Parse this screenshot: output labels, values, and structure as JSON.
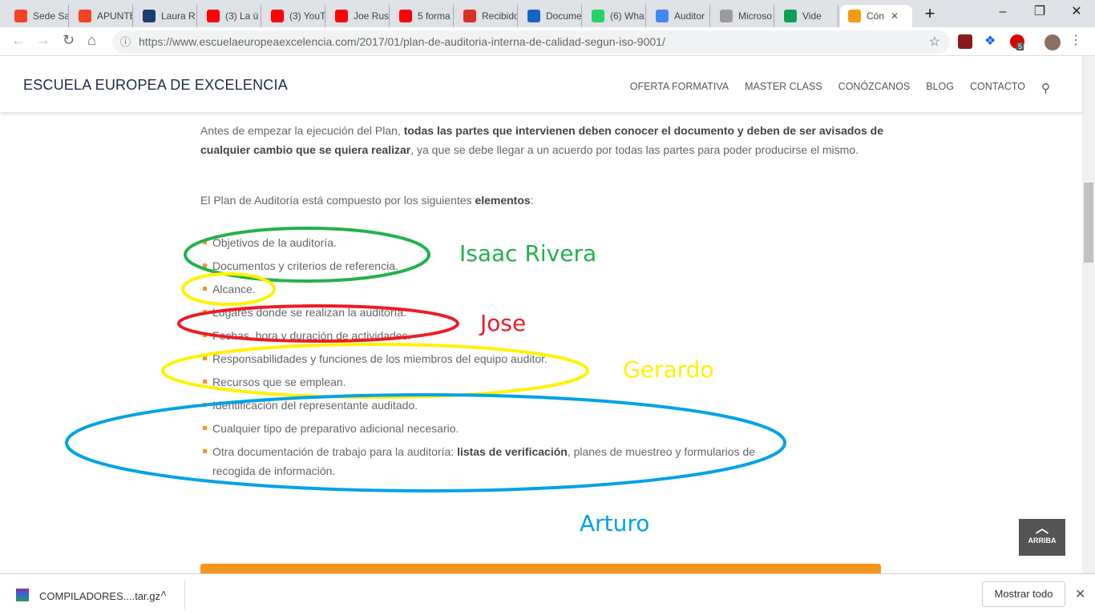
{
  "browser": {
    "tabs": [
      {
        "label": "Sede Sa",
        "icon": "joomla-icon",
        "color": "#f44321"
      },
      {
        "label": "APUNTE",
        "icon": "joomla-icon",
        "color": "#f44321"
      },
      {
        "label": "Laura R",
        "icon": "linkedin-learning-icon",
        "color": "#1b3c6e"
      },
      {
        "label": "(3) La ú",
        "icon": "youtube-icon",
        "color": "#ff0000"
      },
      {
        "label": "(3) YouT",
        "icon": "youtube-icon",
        "color": "#ff0000"
      },
      {
        "label": "Joe Rus",
        "icon": "youtube-icon",
        "color": "#ff0000"
      },
      {
        "label": "5 forma",
        "icon": "youtube-icon",
        "color": "#ff0000"
      },
      {
        "label": "Recibido",
        "icon": "gmail-icon",
        "color": "#d93025"
      },
      {
        "label": "Docume",
        "icon": "td-icon",
        "color": "#1565c0"
      },
      {
        "label": "(6) Wha",
        "icon": "whatsapp-icon",
        "color": "#25d366"
      },
      {
        "label": "Auditor",
        "icon": "google-docs-icon",
        "color": "#4285f4"
      },
      {
        "label": "Microso",
        "icon": "document-icon",
        "color": "#999999"
      },
      {
        "label": "Vide",
        "icon": "hangouts-icon",
        "color": "#0f9d58"
      },
      {
        "label": "Cón",
        "icon": "eee-icon",
        "color": "#f39c12"
      }
    ],
    "url": "https://www.escuelaeuropeaexcelencia.com/2017/01/plan-de-auditoria-interna-de-calidad-segun-iso-9001/",
    "extension_badge": "5"
  },
  "site": {
    "logo": "ESCUELA EUROPEA DE EXCELENCIA",
    "menu": [
      "OFERTA FORMATIVA",
      "MASTER CLASS",
      "CONÓZCANOS",
      "BLOG",
      "CONTACTO"
    ]
  },
  "article": {
    "p1_a": "Antes de empezar la ejecución del Plan, ",
    "p1_b": "todas las partes que intervienen deben conocer el documento y deben de ser avisados de cualquier cambio que se quiera realizar",
    "p1_c": ", ya que se debe llegar a un acuerdo por todas las partes para poder producirse el mismo.",
    "p2_a": "El Plan de Auditoría está compuesto por los siguientes ",
    "p2_b": "elementos",
    "p2_c": ":",
    "items": [
      "Objetivos de la auditoría.",
      "Documentos y criterios de referencia.",
      "Alcance.",
      "Lugares donde se realizan la auditoría.",
      "Fechas, hora y duración de actividades.",
      "Responsabilidades y funciones de los miembros del equipo auditor.",
      "Recursos que se emplean.",
      "Identificación del representante auditado.",
      "Cualquier tipo de preparativo adicional necesario."
    ],
    "last_a": "Otra documentación de trabajo para la auditoría: ",
    "last_b": "listas de verificación",
    "last_c": ", planes de muestreo y formularios de recogida de información."
  },
  "annotations": [
    {
      "name": "Isaac Rivera",
      "color": "#22b14c"
    },
    {
      "name": "Jose",
      "color": "#ed1c24"
    },
    {
      "name": "Gerardo",
      "color": "#fff200"
    },
    {
      "name": "Arturo",
      "color": "#00a2e8"
    }
  ],
  "back_to_top": "ARRIBA",
  "download": {
    "file": "COMPILADORES....tar.gz",
    "show_all": "Mostrar todo"
  }
}
